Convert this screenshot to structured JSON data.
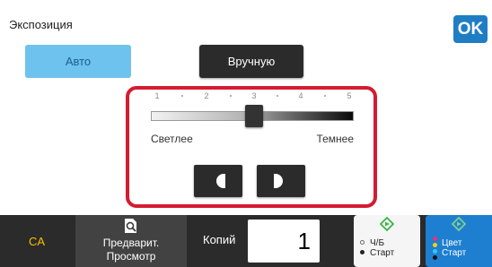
{
  "header": {
    "title": "Экспозиция",
    "ok_label": "OK"
  },
  "mode": {
    "auto_label": "Авто",
    "manual_label": "Вручную",
    "selected": "Вручную"
  },
  "exposure": {
    "scale": [
      "1",
      "2",
      "3",
      "4",
      "5"
    ],
    "value": 3,
    "lighter_label": "Светлее",
    "darker_label": "Темнее"
  },
  "bottom": {
    "ca_label": "CA",
    "preview_line1": "Предварит.",
    "preview_line2": "Просмотр",
    "copies_label": "Копий",
    "copies_value": "1",
    "bw_start_line1": "Ч/Б",
    "bw_start_line2": "Старт",
    "color_start_line1": "Цвет",
    "color_start_line2": "Старт"
  },
  "colors": {
    "ok": "#1f7dc4",
    "auto_button": "#6ec2ee",
    "highlight_border": "#d51b31",
    "color_start": "#1e7fd0",
    "ca_text": "#f5c000",
    "start_icon": "#3cb44a"
  }
}
